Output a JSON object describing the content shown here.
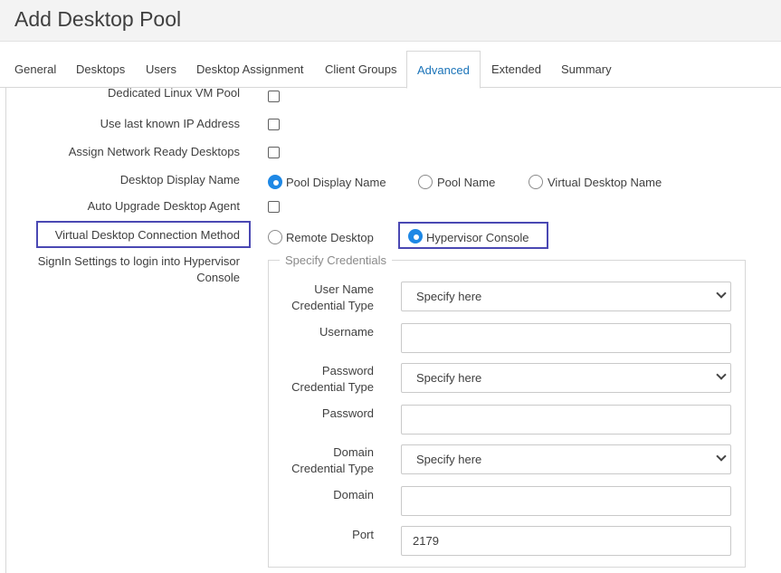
{
  "page": {
    "title": "Add Desktop Pool"
  },
  "tabs": [
    {
      "label": "General"
    },
    {
      "label": "Desktops"
    },
    {
      "label": "Users"
    },
    {
      "label": "Desktop Assignment"
    },
    {
      "label": "Client Groups"
    },
    {
      "label": "Advanced",
      "active": true
    },
    {
      "label": "Extended"
    },
    {
      "label": "Summary"
    }
  ],
  "form": {
    "dedicated_linux_label": "Dedicated Linux VM Pool",
    "use_last_ip_label": "Use last known IP Address",
    "assign_network_ready_label": "Assign Network Ready Desktops",
    "display_name_label": "Desktop Display Name",
    "display_name_options": [
      "Pool Display Name",
      "Pool Name",
      "Virtual Desktop Name"
    ],
    "display_name_selected": "Pool Display Name",
    "auto_upgrade_label": "Auto Upgrade Desktop Agent",
    "connection_method_label": "Virtual Desktop Connection Method",
    "connection_method_options": [
      "Remote Desktop",
      "Hypervisor Console"
    ],
    "connection_method_selected": "Hypervisor Console",
    "signin_label_line1": "SignIn Settings to login into Hypervisor",
    "signin_label_line2": "Console"
  },
  "credentials": {
    "legend": "Specify Credentials",
    "username_type_label_1": "User Name",
    "username_type_label_2": "Credential Type",
    "username_type_value": "Specify here",
    "username_label": "Username",
    "username_value": "",
    "password_type_label_1": "Password",
    "password_type_label_2": "Credential Type",
    "password_type_value": "Specify here",
    "password_label": "Password",
    "password_value": "",
    "domain_type_label_1": "Domain",
    "domain_type_label_2": "Credential Type",
    "domain_type_value": "Specify here",
    "domain_label": "Domain",
    "domain_value": "",
    "port_label": "Port",
    "port_value": "2179"
  },
  "colors": {
    "accent": "#1e88e5",
    "highlight": "#4a48b3",
    "active_tab": "#1a73b8"
  }
}
